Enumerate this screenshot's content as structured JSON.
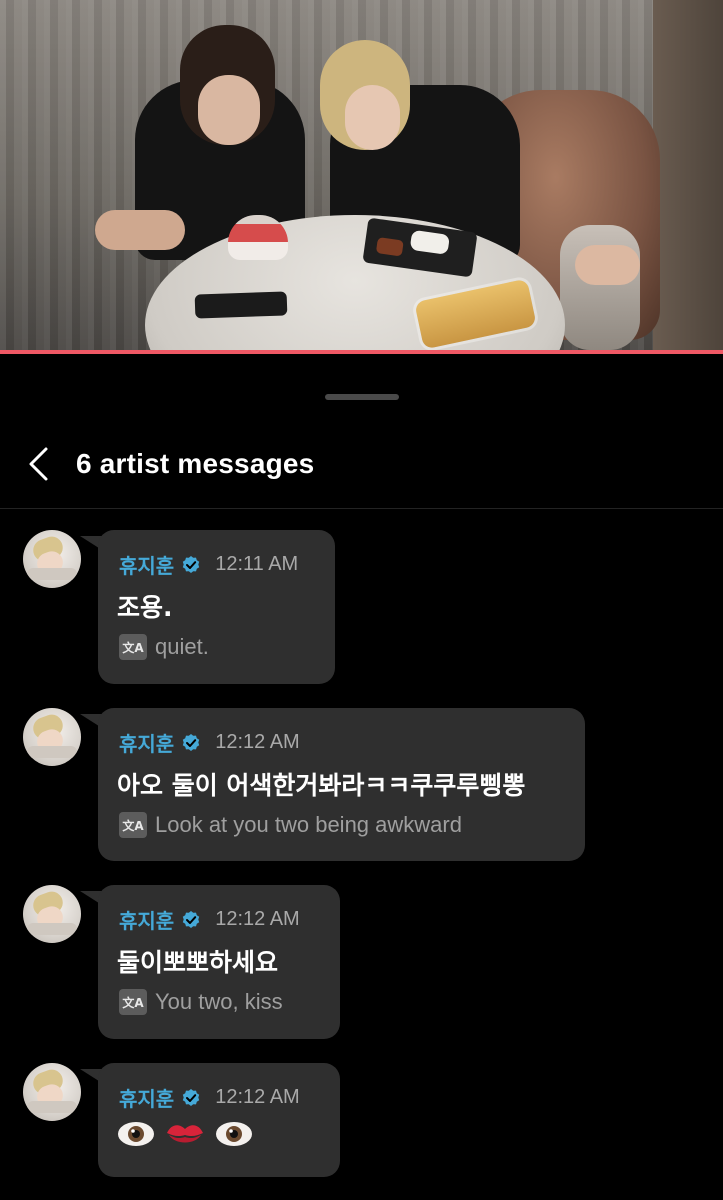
{
  "video": {
    "progress": 1.0
  },
  "header": {
    "back_icon": "chevron-left-icon",
    "title": "6 artist messages"
  },
  "messages": [
    {
      "author": "휴지훈",
      "time": "12:11 AM",
      "text": "조용.",
      "translation": "quiet."
    },
    {
      "author": "휴지훈",
      "time": "12:12 AM",
      "text": "아오 둘이 어색한거봐라ㅋㅋ쿠쿠루삥뽕",
      "translation": "Look at you two being awkward"
    },
    {
      "author": "휴지훈",
      "time": "12:12 AM",
      "text": "둘이뽀뽀하세요",
      "translation": "You two, kiss"
    },
    {
      "author": "휴지훈",
      "time": "12:12 AM",
      "emojis": [
        "eye-emoji",
        "kiss-mark-emoji",
        "eye-emoji"
      ]
    }
  ],
  "colors": {
    "author_name": "#45a9d8",
    "verified_badge": "#45a9d8",
    "bubble": "#2f2f2f",
    "progress": "#ef5865"
  },
  "translate_icon_label": "文A"
}
